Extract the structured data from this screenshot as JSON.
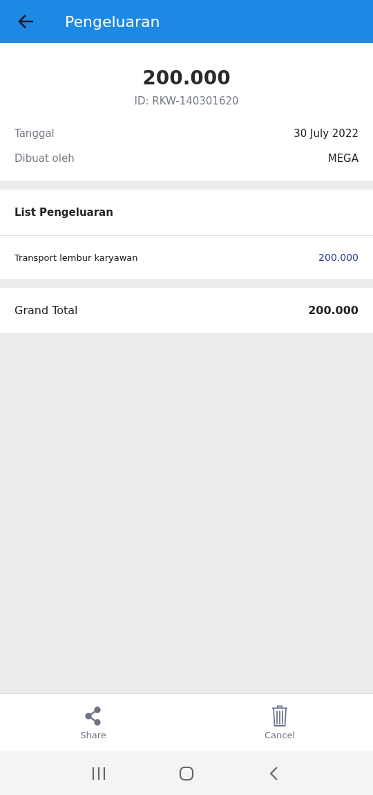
{
  "header": {
    "title": "Pengeluaran"
  },
  "summary": {
    "amount": "200.000",
    "id": "ID: RKW-140301620",
    "fields": [
      {
        "label": "Tanggal",
        "value": "30 July 2022"
      },
      {
        "label": "Dibuat oleh",
        "value": "MEGA"
      }
    ]
  },
  "list": {
    "title": "List Pengeluaran",
    "items": [
      {
        "name": "Transport lembur karyawan",
        "amount": "200.000"
      }
    ]
  },
  "grand_total": {
    "label": "Grand Total",
    "value": "200.000"
  },
  "actions": [
    {
      "kind": "share",
      "label": "Share"
    },
    {
      "kind": "delete",
      "label": "Cancel"
    }
  ],
  "nav_bar": [
    {
      "kind": "recents"
    },
    {
      "kind": "home"
    },
    {
      "kind": "back"
    }
  ]
}
